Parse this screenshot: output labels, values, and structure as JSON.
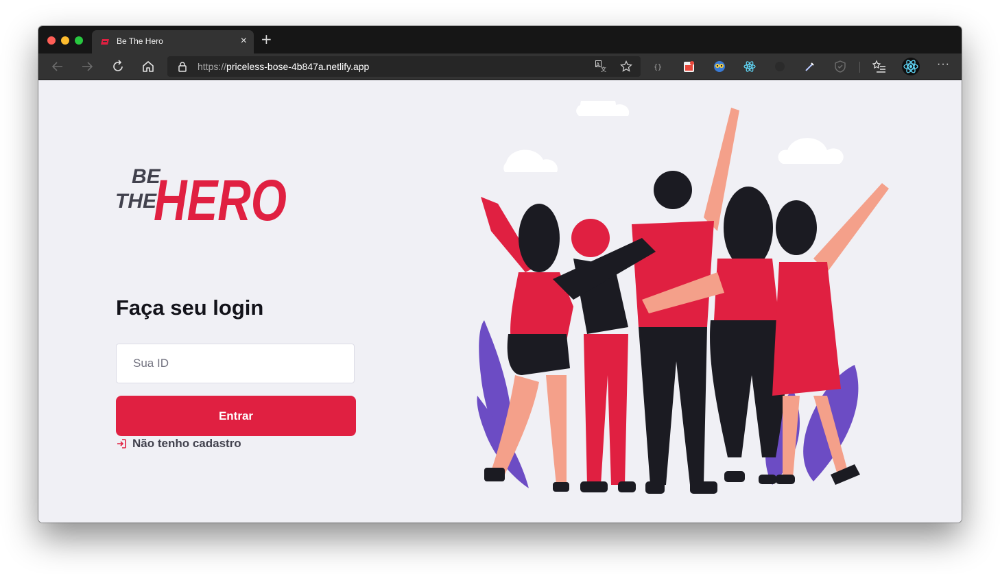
{
  "browser": {
    "tab": {
      "title": "Be The Hero",
      "close": "×"
    },
    "new_tab": "+",
    "url": {
      "scheme": "https://",
      "host": "priceless-bose-4b847a.netlify.app"
    },
    "more": "···"
  },
  "page": {
    "logo": {
      "line1": "BE",
      "line2": "THE",
      "word": "HERO"
    },
    "login_title": "Faça seu login",
    "id_input": {
      "placeholder": "Sua ID",
      "value": ""
    },
    "enter_button": "Entrar",
    "register_link": "Não tenho cadastro"
  },
  "colors": {
    "brand_red": "#e02041",
    "page_background": "#f0f0f5",
    "text_dark": "#13131a",
    "text_muted": "#41414d"
  },
  "icons": {
    "back": "arrow-left-icon",
    "forward": "arrow-right-icon",
    "reload": "reload-icon",
    "home": "home-icon",
    "lock": "lock-icon",
    "translate": "translate-icon",
    "favorite": "star-icon",
    "collections": "collections-icon",
    "register": "log-in-icon"
  }
}
